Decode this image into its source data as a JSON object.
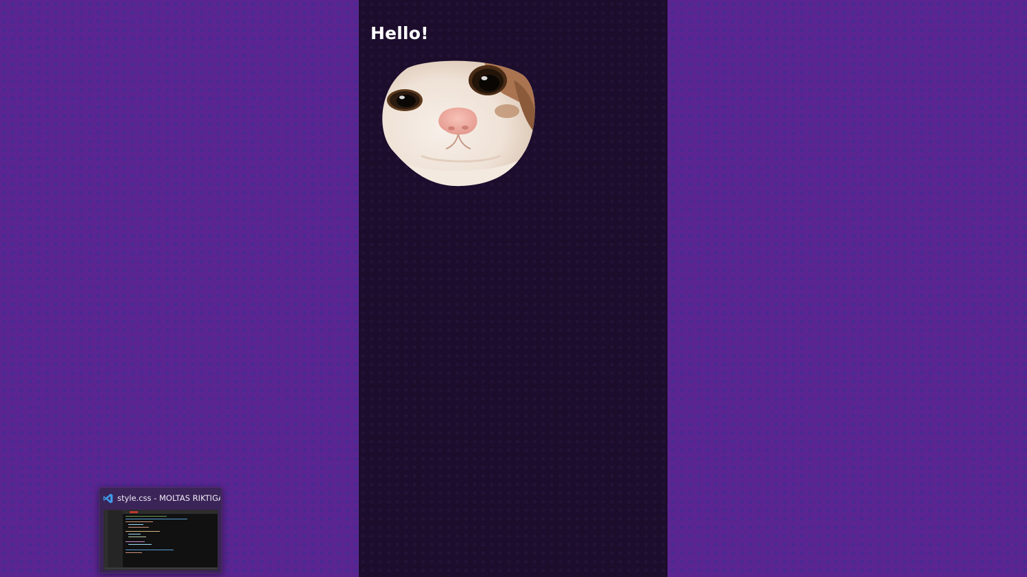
{
  "page": {
    "heading": "Hello!",
    "image_alt": "cat face"
  },
  "taskbar_preview": {
    "icon": "vscode-icon",
    "title": "style.css - MOLTAS RIKTIGA..."
  },
  "colors": {
    "outer_background": "#5a2590",
    "heart_pattern": "#4a2a92",
    "column_background": "#1d0d2d",
    "heading_text": "#ffffff",
    "vscode_blue": "#3d9be9"
  }
}
